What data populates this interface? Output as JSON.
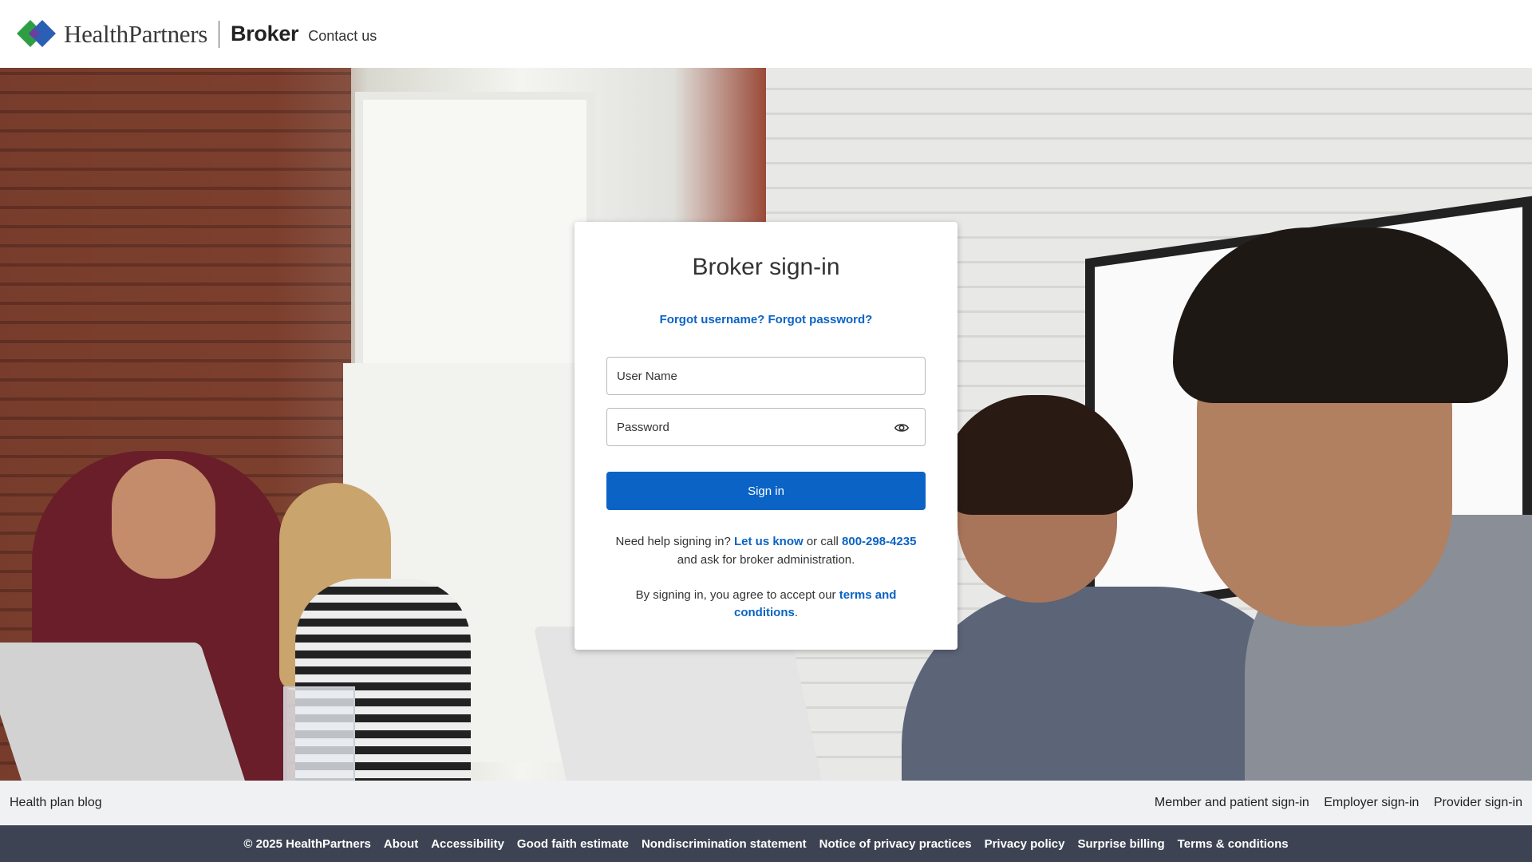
{
  "header": {
    "logo_text": "HealthPartners",
    "product": "Broker",
    "contact": "Contact us"
  },
  "card": {
    "title": "Broker sign-in",
    "forgot_username": "Forgot username?",
    "forgot_password": "Forgot password?",
    "username_placeholder": "User Name",
    "password_placeholder": "Password",
    "signin_label": "Sign in",
    "help_prefix": "Need help signing in?",
    "help_link": "Let us know",
    "help_mid": "or call",
    "help_phone": "800-298-4235",
    "help_suffix": "and ask for broker administration.",
    "terms_prefix": "By signing in, you agree to accept our",
    "terms_link": "terms and conditions",
    "terms_suffix": "."
  },
  "subfooter": {
    "left": "Health plan blog",
    "right": [
      "Member and patient sign-in",
      "Employer sign-in",
      "Provider sign-in"
    ]
  },
  "footer": {
    "copyright": "© 2025 HealthPartners",
    "links": [
      "About",
      "Accessibility",
      "Good faith estimate",
      "Nondiscrimination statement",
      "Notice of privacy practices",
      "Privacy policy",
      "Surprise billing",
      "Terms & conditions"
    ]
  },
  "colors": {
    "accent": "#0b63c5",
    "footer_bg": "#3d4352",
    "subfooter_bg": "#f0f1f3"
  },
  "icons": {
    "logo": "healthpartners-diamond-logo",
    "password_toggle": "eye-icon"
  }
}
